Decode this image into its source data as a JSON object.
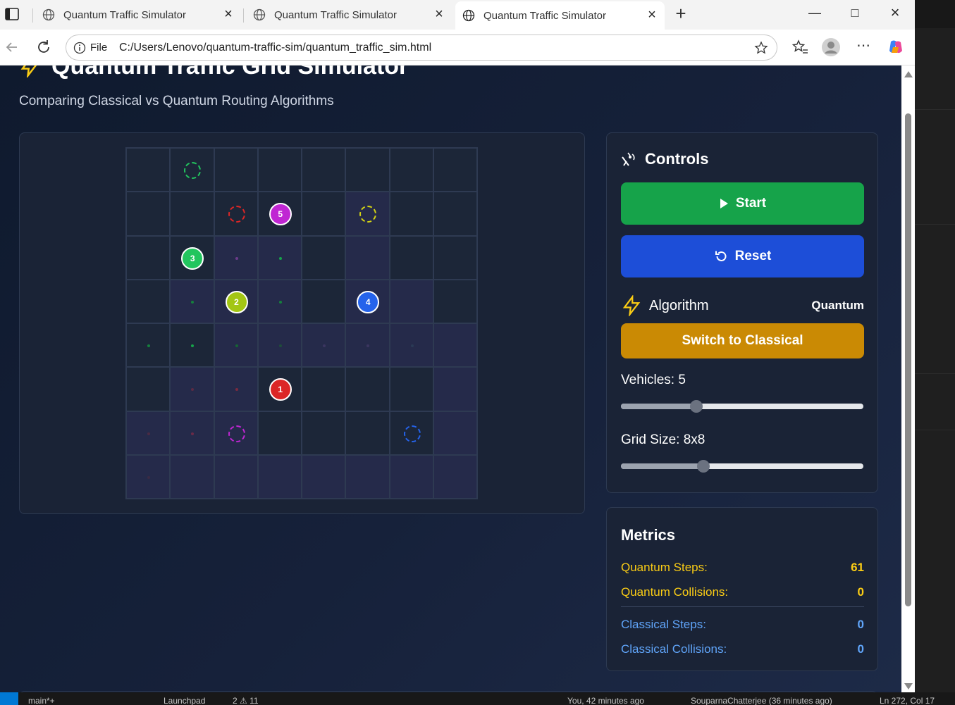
{
  "browser": {
    "tabs": [
      {
        "title": "Quantum Traffic Simulator",
        "active": false
      },
      {
        "title": "Quantum Traffic Simulator",
        "active": false
      },
      {
        "title": "Quantum Traffic Simulator",
        "active": true
      }
    ],
    "address": {
      "scheme_label": "File",
      "url": "C:/Users/Lenovo/quantum-traffic-sim/quantum_traffic_sim.html"
    }
  },
  "page": {
    "title": "Quantum Traffic Grid Simulator",
    "subtitle": "Comparing Classical vs Quantum Routing Algorithms"
  },
  "grid": {
    "size": 8,
    "vehicles": [
      {
        "id": "1",
        "row": 5,
        "col": 3,
        "color": "#dc2626"
      },
      {
        "id": "2",
        "row": 3,
        "col": 2,
        "color": "#a3c614"
      },
      {
        "id": "3",
        "row": 2,
        "col": 1,
        "color": "#22c55e"
      },
      {
        "id": "4",
        "row": 3,
        "col": 5,
        "color": "#2563eb"
      },
      {
        "id": "5",
        "row": 1,
        "col": 3,
        "color": "#c026d3"
      }
    ],
    "destinations": [
      {
        "row": 0,
        "col": 1,
        "color": "#22c55e"
      },
      {
        "row": 1,
        "col": 2,
        "color": "#dc2626"
      },
      {
        "row": 1,
        "col": 5,
        "color": "#d4d414"
      },
      {
        "row": 6,
        "col": 2,
        "color": "#c026d3"
      },
      {
        "row": 6,
        "col": 6,
        "color": "#2563eb"
      }
    ],
    "highlight_cells": [
      [
        1,
        5
      ],
      [
        2,
        2
      ],
      [
        2,
        3
      ],
      [
        2,
        5
      ],
      [
        3,
        1
      ],
      [
        3,
        2
      ],
      [
        3,
        3
      ],
      [
        3,
        5
      ],
      [
        3,
        6
      ],
      [
        4,
        2
      ],
      [
        4,
        3
      ],
      [
        4,
        4
      ],
      [
        4,
        5
      ],
      [
        4,
        6
      ],
      [
        4,
        7
      ],
      [
        5,
        1
      ],
      [
        5,
        2
      ],
      [
        5,
        7
      ],
      [
        6,
        0
      ],
      [
        6,
        1
      ],
      [
        6,
        2
      ],
      [
        6,
        7
      ],
      [
        7,
        0
      ],
      [
        7,
        1
      ],
      [
        7,
        2
      ],
      [
        7,
        3
      ],
      [
        7,
        4
      ],
      [
        7,
        5
      ],
      [
        7,
        6
      ],
      [
        7,
        7
      ]
    ],
    "trail_dots": [
      {
        "row": 2,
        "col": 2,
        "color": "#6b3b8a"
      },
      {
        "row": 2,
        "col": 3,
        "color": "#16a34a"
      },
      {
        "row": 3,
        "col": 1,
        "color": "#15803d"
      },
      {
        "row": 3,
        "col": 3,
        "color": "#15803d"
      },
      {
        "row": 4,
        "col": 0,
        "color": "#15803d"
      },
      {
        "row": 4,
        "col": 1,
        "color": "#16a34a"
      },
      {
        "row": 4,
        "col": 2,
        "color": "#166534"
      },
      {
        "row": 4,
        "col": 3,
        "color": "#1f4d3a"
      },
      {
        "row": 4,
        "col": 4,
        "color": "#3b3560"
      },
      {
        "row": 4,
        "col": 5,
        "color": "#3b3560"
      },
      {
        "row": 4,
        "col": 6,
        "color": "#2a3a55"
      },
      {
        "row": 5,
        "col": 1,
        "color": "#5b2a44"
      },
      {
        "row": 5,
        "col": 2,
        "color": "#7a2a40"
      },
      {
        "row": 6,
        "col": 0,
        "color": "#4a2a44"
      },
      {
        "row": 6,
        "col": 1,
        "color": "#6a2a48"
      },
      {
        "row": 7,
        "col": 0,
        "color": "#3a2a44"
      }
    ]
  },
  "controls": {
    "heading": "Controls",
    "start_label": "Start",
    "reset_label": "Reset",
    "algorithm_label": "Algorithm",
    "algorithm_value": "Quantum",
    "switch_label": "Switch to Classical",
    "vehicles_label": "Vehicles: 5",
    "vehicles_fraction": 0.31,
    "grid_size_label": "Grid Size: 8x8",
    "grid_size_fraction": 0.34
  },
  "metrics": {
    "heading": "Metrics",
    "quantum_steps_label": "Quantum Steps:",
    "quantum_steps": "61",
    "quantum_collisions_label": "Quantum Collisions:",
    "quantum_collisions": "0",
    "classical_steps_label": "Classical Steps:",
    "classical_steps": "0",
    "classical_collisions_label": "Classical Collisions:",
    "classical_collisions": "0"
  },
  "statusbar": {
    "branch": "main*+",
    "launch": "Launchpad",
    "problems": "2 ⚠ 11",
    "blame": "You, 42 minutes ago",
    "author": "SouparnaChatterjee (36 minutes ago)",
    "position": "Ln 272, Col 17"
  },
  "colors": {
    "accent_green": "#16a34a",
    "accent_blue": "#1d4ed8",
    "accent_amber": "#ca8a04",
    "quantum_metric": "#facc15",
    "classical_metric": "#60a5fa"
  }
}
